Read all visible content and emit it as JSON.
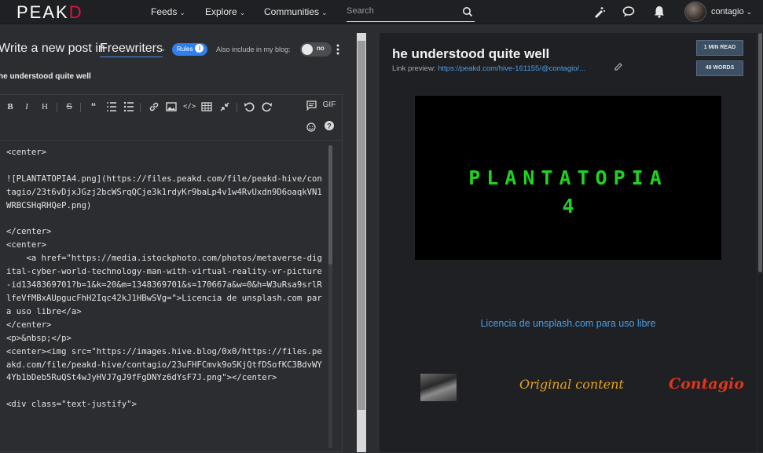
{
  "nav": {
    "logo_main": "PEAK",
    "logo_accent": "D",
    "menu": [
      {
        "label": "Feeds"
      },
      {
        "label": "Explore"
      },
      {
        "label": "Communities"
      }
    ],
    "search_placeholder": "Search",
    "username": "contagio"
  },
  "editor": {
    "write_label": "Write a new post in",
    "community": "Freewriters",
    "rules_label": "Rules",
    "blog_label": "Also include in my blog:",
    "toggle_label": "no",
    "post_title": "he understood quite well",
    "gif_label": "GIF",
    "code": "<center>\n\n![PLANTATOPIA4.png](https://files.peakd.com/file/peakd-hive/contagio/23t6vDjxJGzj2bcWSrqQCje3k1rdyKr9baLp4v1w4RvUxdn9D6oaqkVN1WRBCSHqRHQeP.png)\n\n</center>\n<center>\n    <a href=\"https://media.istockphoto.com/photos/metaverse-digital-cyber-world-technology-man-with-virtual-reality-vr-picture-id1348369701?b=1&k=20&m=1348369701&s=170667a&w=0&h=W3uRsa9srlRlfeVfMBxAUpgucFhH2Iqc42kJ1HBwSVg=\">Licencia de unsplash.com para uso libre</a>\n</center>\n<p>&nbsp;</p>\n<center><img src=\"https://images.hive.blog/0x0/https://files.peakd.com/file/peakd-hive/contagio/23uFHFCmvk9oSKjQtfDSofKC3BdvWY4Yb1bDeb5RuQSt4wJyHVJ7gJ9fFgDNYz6dYsF7J.png\"></center>\n\n<div class=\"text-justify\">"
  },
  "preview": {
    "title": "he understood quite well",
    "link_label": "Link preview:",
    "link_url": "https://peakd.com/hive-161155/@contagio/...",
    "read_time": "1 MIN READ",
    "word_count": "48 WORDS",
    "hero_line1": "PLANTATOPIA",
    "hero_line2": "4",
    "licencia": "Licencia de unsplash.com para uso libre",
    "original_content": "Original content",
    "contagio_logo": "Contagio"
  },
  "colors": {
    "brand_red": "#e31337",
    "accent_blue": "#2f80ed",
    "link_blue": "#4a9fe8",
    "hero_green": "#1fd41f"
  }
}
